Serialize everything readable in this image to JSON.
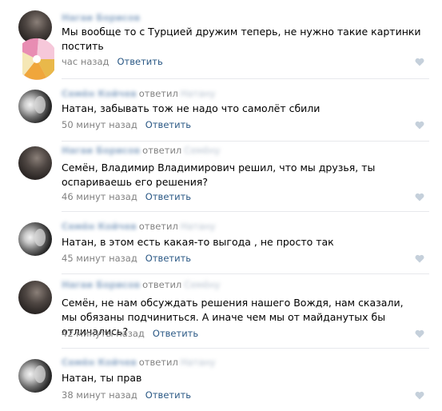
{
  "comments": [
    {
      "author": "Нагаи Борисов",
      "reply_to": "",
      "text": "Мы вообще то с Турцией дружим теперь, не нужно такие картинки постить",
      "time": "час назад",
      "reply_label": "Ответить"
    },
    {
      "author": "Семён Койчев",
      "replied_label": "ответил",
      "reply_to": "Натану",
      "text": "Натан, забывать тож не надо что самолёт сбили",
      "time": "50 минут назад",
      "reply_label": "Ответить"
    },
    {
      "author": "Нагаи Борисов",
      "replied_label": "ответил",
      "reply_to": "Семёну",
      "text": "Семён, Владимир Владимирович решил, что мы друзья, ты оспариваешь его решения?",
      "time": "46 минут назад",
      "reply_label": "Ответить"
    },
    {
      "author": "Семён Койчев",
      "replied_label": "ответил",
      "reply_to": "Натану",
      "text": "Натан, в этом есть какая-то выгода , не просто так",
      "time": "45 минут назад",
      "reply_label": "Ответить"
    },
    {
      "author": "Нагаи Борисов",
      "replied_label": "ответил",
      "reply_to": "Семёну",
      "text": "Семён, не нам обсуждать решения нашего Вождя, нам сказали, мы обязаны подчиниться. А иначе чем мы от майданутых бы отличались?",
      "time": "42 минуты назад",
      "reply_label": "Ответить"
    },
    {
      "author": "Семён Койчев",
      "replied_label": "ответил",
      "reply_to": "Натану",
      "text": "Натан, ты прав",
      "time": "38 минут назад",
      "reply_label": "Ответить"
    }
  ],
  "icons": {
    "like": "heart-icon"
  },
  "colors": {
    "link": "#2a5885",
    "meta": "#828282",
    "like": "#c5d0db",
    "divider": "#e7e8ec"
  }
}
